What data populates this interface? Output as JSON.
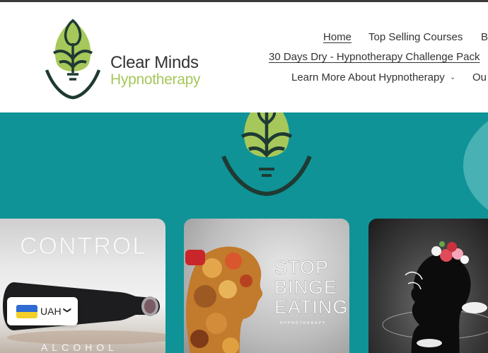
{
  "brand": {
    "name_line1": "Clear Minds",
    "name_line2": "Hypnotherapy",
    "colors": {
      "leaf": "#a6c85a",
      "dark": "#1f3a33",
      "teal": "#0f9396"
    }
  },
  "nav": {
    "home": "Home",
    "top_selling": "Top Selling Courses",
    "b_cut": "B",
    "challenge": "30 Days Dry - Hypnotherapy Challenge Pack",
    "learn_more": "Learn More About Hypnotherapy",
    "learn_more_icon": "chevron-down-icon",
    "ou_cut": "Ou"
  },
  "cards": [
    {
      "title": "CONTROL",
      "subtitle": "ALCOHOL"
    },
    {
      "title_lines": [
        "STOP",
        "BINGE",
        "EATING"
      ],
      "subtitle": "HYPNOTHERAPY"
    },
    {
      "title": ""
    }
  ],
  "currency": {
    "code": "UAH",
    "flag": "ukraine-flag",
    "icon": "chevron-down-icon"
  }
}
